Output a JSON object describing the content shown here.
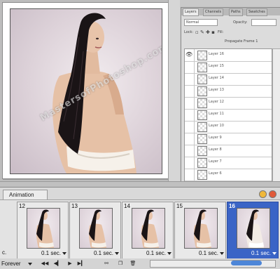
{
  "watermark": "MastersofPhotoshop.com",
  "layers_panel": {
    "tabs": [
      "Layers",
      "Channels",
      "Paths",
      "Swatches"
    ],
    "blend_mode": "Normal",
    "opacity_label": "Opacity:",
    "lock_label": "Lock:",
    "fill_label": "Fill:",
    "propagate_label": "Propagate Frame 1",
    "layer_names": [
      "Layer 16",
      "Layer 15",
      "Layer 14",
      "Layer 13",
      "Layer 12",
      "Layer 11",
      "Layer 10",
      "Layer 9",
      "Layer 8",
      "Layer 7",
      "Layer 6"
    ]
  },
  "animation_panel": {
    "tab_label": "Animation",
    "frames": [
      {
        "number": "12",
        "delay": "0.1 sec."
      },
      {
        "number": "13",
        "delay": "0.1 sec."
      },
      {
        "number": "14",
        "delay": "0.1 sec."
      },
      {
        "number": "15",
        "delay": "0.1 sec."
      },
      {
        "number": "16",
        "delay": "0.1 sec."
      }
    ],
    "partial_frame_label": "c.",
    "selected_frame": "16",
    "loop_option": "Forever"
  },
  "colors": {
    "selection": "#3a64c6",
    "hair": "#1a1416",
    "skin": "#e6c1a6"
  },
  "icons": [
    "eye-icon",
    "first-frame-icon",
    "previous-frame-icon",
    "play-icon",
    "next-frame-icon",
    "tween-icon",
    "new-frame-icon",
    "delete-icon",
    "dropdown-arrow-icon"
  ]
}
